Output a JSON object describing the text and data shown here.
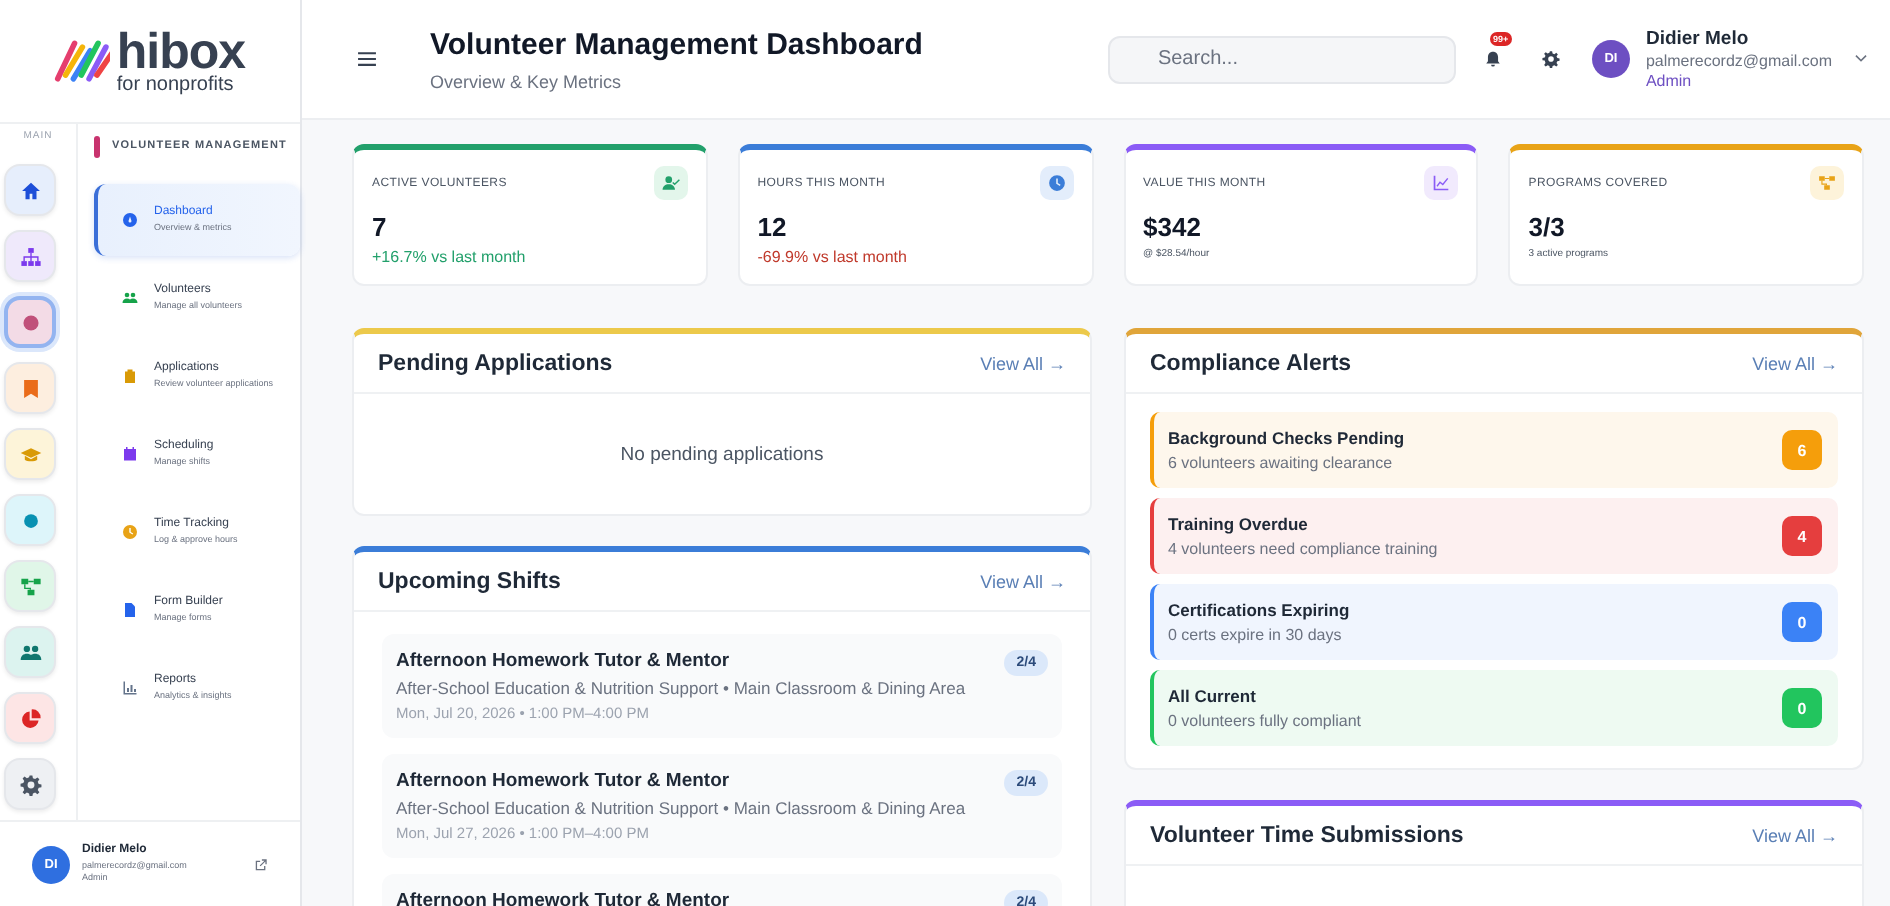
{
  "brand": {
    "name": "hibox",
    "tagline": "for nonprofits"
  },
  "rail": {
    "label": "MAIN",
    "items": [
      {
        "selected": false
      },
      {
        "selected": false
      },
      {
        "selected": true
      },
      {
        "selected": false
      },
      {
        "selected": false
      },
      {
        "selected": false
      },
      {
        "selected": false
      },
      {
        "selected": false
      },
      {
        "selected": false
      },
      {
        "selected": false
      }
    ]
  },
  "nav": {
    "section": "VOLUNTEER MANAGEMENT",
    "items": [
      {
        "label": "Dashboard",
        "sub": "Overview & metrics",
        "selected": true
      },
      {
        "label": "Volunteers",
        "sub": "Manage all volunteers",
        "selected": false
      },
      {
        "label": "Applications",
        "sub": "Review volunteer applications",
        "selected": false
      },
      {
        "label": "Scheduling",
        "sub": "Manage shifts",
        "selected": false
      },
      {
        "label": "Time Tracking",
        "sub": "Log & approve hours",
        "selected": false
      },
      {
        "label": "Form Builder",
        "sub": "Manage forms",
        "selected": false
      },
      {
        "label": "Reports",
        "sub": "Analytics & insights",
        "selected": false
      }
    ]
  },
  "sidebar_user": {
    "initials": "DI",
    "name": "Didier Melo",
    "email": "palmerecordz@gmail.com",
    "role": "Admin"
  },
  "header": {
    "title": "Volunteer Management Dashboard",
    "subtitle": "Overview & Key Metrics",
    "search": {
      "placeholder": "Search..."
    },
    "notifications": "99+",
    "user": {
      "initials": "DI",
      "name": "Didier Melo",
      "email": "palmerecordz@gmail.com",
      "role": "Admin"
    }
  },
  "stats": [
    {
      "label": "ACTIVE VOLUNTEERS",
      "value": "7",
      "note": "+16.7% vs last month",
      "kind": "gain",
      "color": "#22a06b"
    },
    {
      "label": "HOURS THIS MONTH",
      "value": "12",
      "note": "-69.9% vs last month",
      "kind": "loss",
      "color": "#3b7dd8"
    },
    {
      "label": "VALUE THIS MONTH",
      "value": "$342",
      "note": "@ $28.54/hour",
      "kind": "info",
      "color": "#8b5cf6"
    },
    {
      "label": "PROGRAMS COVERED",
      "value": "3/3",
      "note": "3 active programs",
      "kind": "info",
      "color": "#e8a317"
    }
  ],
  "pending": {
    "title": "Pending Applications",
    "link": "View All →",
    "empty": "No pending applications"
  },
  "shifts": {
    "title": "Upcoming Shifts",
    "link": "View All →",
    "items": [
      {
        "title": "Afternoon Homework Tutor & Mentor",
        "detail": "After-School Education & Nutrition Support • Main Classroom & Dining Area",
        "when": "Mon, Jul 20, 2026 • 1:00 PM–4:00 PM",
        "filled": "2/4"
      },
      {
        "title": "Afternoon Homework Tutor & Mentor",
        "detail": "After-School Education & Nutrition Support • Main Classroom & Dining Area",
        "when": "Mon, Jul 27, 2026 • 1:00 PM–4:00 PM",
        "filled": "2/4"
      },
      {
        "title": "Afternoon Homework Tutor & Mentor",
        "filled": "2/4"
      }
    ]
  },
  "compliance": {
    "title": "Compliance Alerts",
    "link": "View All →",
    "alerts": [
      {
        "title": "Background Checks Pending",
        "detail": "6 volunteers awaiting clearance",
        "count": "6",
        "color": "#f59e0b"
      },
      {
        "title": "Training Overdue",
        "detail": "4 volunteers need compliance training",
        "count": "4",
        "color": "#e53e3e"
      },
      {
        "title": "Certifications Expiring",
        "detail": "0 certs expire in 30 days",
        "count": "0",
        "color": "#3b82f6"
      },
      {
        "title": "All Current",
        "detail": "0 volunteers fully compliant",
        "count": "0",
        "color": "#22c55e"
      }
    ]
  },
  "submissions": {
    "title": "Volunteer Time Submissions",
    "link": "View All →"
  }
}
